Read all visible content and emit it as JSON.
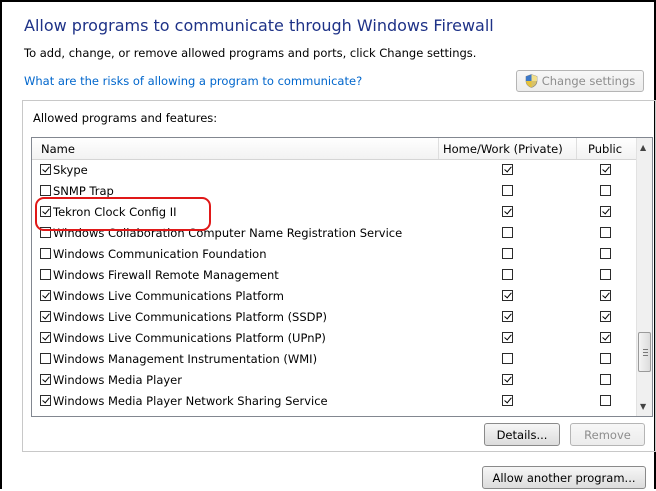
{
  "title": "Allow programs to communicate through Windows Firewall",
  "subtitle": "To add, change, or remove allowed programs and ports, click Change settings.",
  "risk_link": "What are the risks of allowing a program to communicate?",
  "change_settings_label": "Change settings",
  "group_label": "Allowed programs and features:",
  "columns": {
    "name": "Name",
    "private": "Home/Work (Private)",
    "public": "Public"
  },
  "rows": [
    {
      "name": "Skype",
      "enabled": true,
      "private": true,
      "public": true
    },
    {
      "name": "SNMP Trap",
      "enabled": false,
      "private": false,
      "public": false
    },
    {
      "name": "Tekron Clock Config II",
      "enabled": true,
      "private": true,
      "public": true
    },
    {
      "name": "Windows Collaboration Computer Name Registration Service",
      "enabled": false,
      "private": false,
      "public": false
    },
    {
      "name": "Windows Communication Foundation",
      "enabled": false,
      "private": false,
      "public": false
    },
    {
      "name": "Windows Firewall Remote Management",
      "enabled": false,
      "private": false,
      "public": false
    },
    {
      "name": "Windows Live Communications Platform",
      "enabled": true,
      "private": true,
      "public": true
    },
    {
      "name": "Windows Live Communications Platform (SSDP)",
      "enabled": true,
      "private": true,
      "public": true
    },
    {
      "name": "Windows Live Communications Platform (UPnP)",
      "enabled": true,
      "private": true,
      "public": true
    },
    {
      "name": "Windows Management Instrumentation (WMI)",
      "enabled": false,
      "private": false,
      "public": false
    },
    {
      "name": "Windows Media Player",
      "enabled": true,
      "private": true,
      "public": false
    },
    {
      "name": "Windows Media Player Network Sharing Service",
      "enabled": true,
      "private": true,
      "public": false
    }
  ],
  "details_label": "Details...",
  "remove_label": "Remove",
  "allow_another_label": "Allow another program...",
  "colors": {
    "title": "#1e3287",
    "link": "#0066cc",
    "highlight": "#e01818"
  },
  "icons": {
    "change_settings": "uac-shield-icon",
    "scroll_up": "arrow-up-icon",
    "scroll_down": "arrow-down-icon"
  }
}
